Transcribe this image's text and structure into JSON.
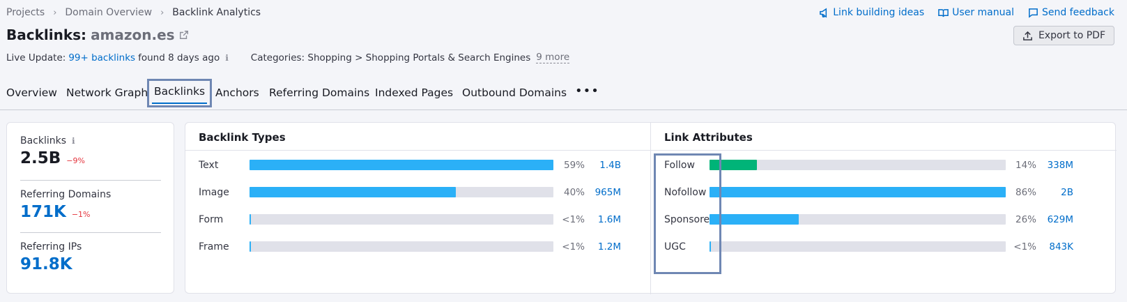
{
  "breadcrumb": [
    "Projects",
    "Domain Overview",
    "Backlink Analytics"
  ],
  "top_links": {
    "link_ideas": "Link building ideas",
    "manual": "User manual",
    "feedback": "Send feedback"
  },
  "title": {
    "prefix": "Backlinks:",
    "domain": "amazon.es"
  },
  "export_label": "Export to PDF",
  "live_update": {
    "label": "Live Update:",
    "link": "99+ backlinks",
    "suffix": "found 8 days ago",
    "categories": "Categories: Shopping > Shopping Portals & Search Engines",
    "more": "9 more"
  },
  "tabs": [
    "Overview",
    "Network Graph",
    "Backlinks",
    "Anchors",
    "Referring Domains",
    "Indexed Pages",
    "Outbound Domains",
    "•••"
  ],
  "active_tab": "Backlinks",
  "summary": [
    {
      "label": "Backlinks",
      "value": "2.5B",
      "delta": "−9%"
    },
    {
      "label": "Referring Domains",
      "value": "171K",
      "delta": "−1%"
    },
    {
      "label": "Referring IPs",
      "value": "91.8K",
      "delta": ""
    }
  ],
  "backlink_types": {
    "title": "Backlink Types",
    "rows": [
      {
        "label": "Text",
        "pct": "59%",
        "value": "1.4B",
        "fill": 1.0
      },
      {
        "label": "Image",
        "pct": "40%",
        "value": "965M",
        "fill": 0.68
      },
      {
        "label": "Form",
        "pct": "<1%",
        "value": "1.6M",
        "fill": 0.005
      },
      {
        "label": "Frame",
        "pct": "<1%",
        "value": "1.2M",
        "fill": 0.005
      }
    ]
  },
  "link_attributes": {
    "title": "Link Attributes",
    "rows": [
      {
        "label": "Follow",
        "pct": "14%",
        "value": "338M",
        "fill": 0.16,
        "color": "#00b478"
      },
      {
        "label": "Nofollow",
        "pct": "86%",
        "value": "2B",
        "fill": 1.0,
        "color": "#2bb0f7"
      },
      {
        "label": "Sponsored",
        "pct": "26%",
        "value": "629M",
        "fill": 0.3,
        "color": "#2bb0f7"
      },
      {
        "label": "UGC",
        "pct": "<1%",
        "value": "843K",
        "fill": 0.005,
        "color": "#2bb0f7"
      }
    ]
  },
  "colors": {
    "bar_blue": "#2bb0f7",
    "bar_green": "#00b478",
    "link_blue": "#006dca",
    "negative": "#e4343d"
  }
}
